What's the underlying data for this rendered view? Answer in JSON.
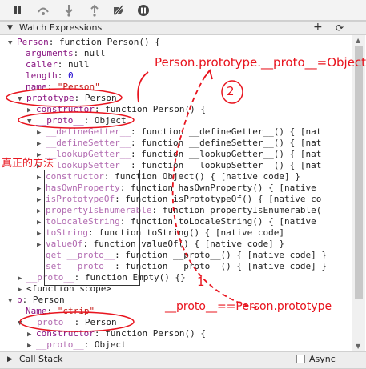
{
  "toolbar": {
    "buttons": [
      "pause-icon",
      "step-over-icon",
      "step-into-icon",
      "step-out-icon",
      "deactivate-breakpoints-icon",
      "pause-on-exceptions-icon"
    ]
  },
  "watch": {
    "title": "Watch Expressions",
    "add": "+",
    "refresh": "⟳"
  },
  "tree": {
    "person": {
      "key": "Person",
      "val": "function Person() {"
    },
    "arguments": {
      "key": "arguments",
      "val": "null"
    },
    "caller": {
      "key": "caller",
      "val": "null"
    },
    "length": {
      "key": "length",
      "val": "0"
    },
    "name": {
      "key": "name",
      "val": "\"Person\""
    },
    "prototype": {
      "key": "prototype",
      "val": "Person"
    },
    "constructor1": {
      "key": "constructor",
      "val": "function Person() {"
    },
    "proto1": {
      "key": "__proto__",
      "val": "Object"
    },
    "defineGetter": {
      "key": "__defineGetter__",
      "val": "function __defineGetter__() { [nat"
    },
    "defineSetter": {
      "key": "__defineSetter__",
      "val": "function __defineSetter__() { [nat"
    },
    "lookupGetter": {
      "key": "__lookupGetter__",
      "val": "function __lookupGetter__() { [nat"
    },
    "lookupSetter": {
      "key": "__lookupSetter__",
      "val": "function __lookupSetter__() { [nat"
    },
    "constructor2": {
      "key": "constructor",
      "val": "function Object() { [native code] }"
    },
    "hasOwnProperty": {
      "key": "hasOwnProperty",
      "val": "function hasOwnProperty() { [native"
    },
    "isPrototypeOf": {
      "key": "isPrototypeOf",
      "val": "function isPrototypeOf() { [native co"
    },
    "propertyIsEnumerable": {
      "key": "propertyIsEnumerable",
      "val": "function propertyIsEnumerable("
    },
    "toLocaleString": {
      "key": "toLocaleString",
      "val": "function toLocaleString() { [native"
    },
    "toString": {
      "key": "toString",
      "val": "function toString() { [native code]"
    },
    "valueOf": {
      "key": "valueOf",
      "val": "function valueOf() { [native code] }"
    },
    "getProto": {
      "key": "get __proto__",
      "val": "function __proto__() { [native code] }"
    },
    "setProto": {
      "key": "set __proto__",
      "val": "function __proto__() { [native code] }"
    },
    "proto2": {
      "key": "__proto__",
      "val": "function Empty() {}"
    },
    "scope": {
      "text": "<function scope>"
    },
    "p": {
      "key": "p",
      "val": "Person"
    },
    "pname": {
      "key": "Name",
      "val": "\"ctrip\""
    },
    "proto3": {
      "key": "__proto__",
      "val": "Person"
    },
    "constructor3": {
      "key": "constructor",
      "val": "function Person() {"
    },
    "proto4": {
      "key": "__proto__",
      "val": "Object"
    }
  },
  "callstack": {
    "title": "Call Stack",
    "async": "Async"
  },
  "annotations": {
    "top_text": "Person.prototype.__proto__=Object",
    "num2": "2",
    "real_methods": "真正的方法",
    "num1": "1",
    "bottom_text": "__proto__==Person.prototype",
    "color": "#e8141e"
  }
}
